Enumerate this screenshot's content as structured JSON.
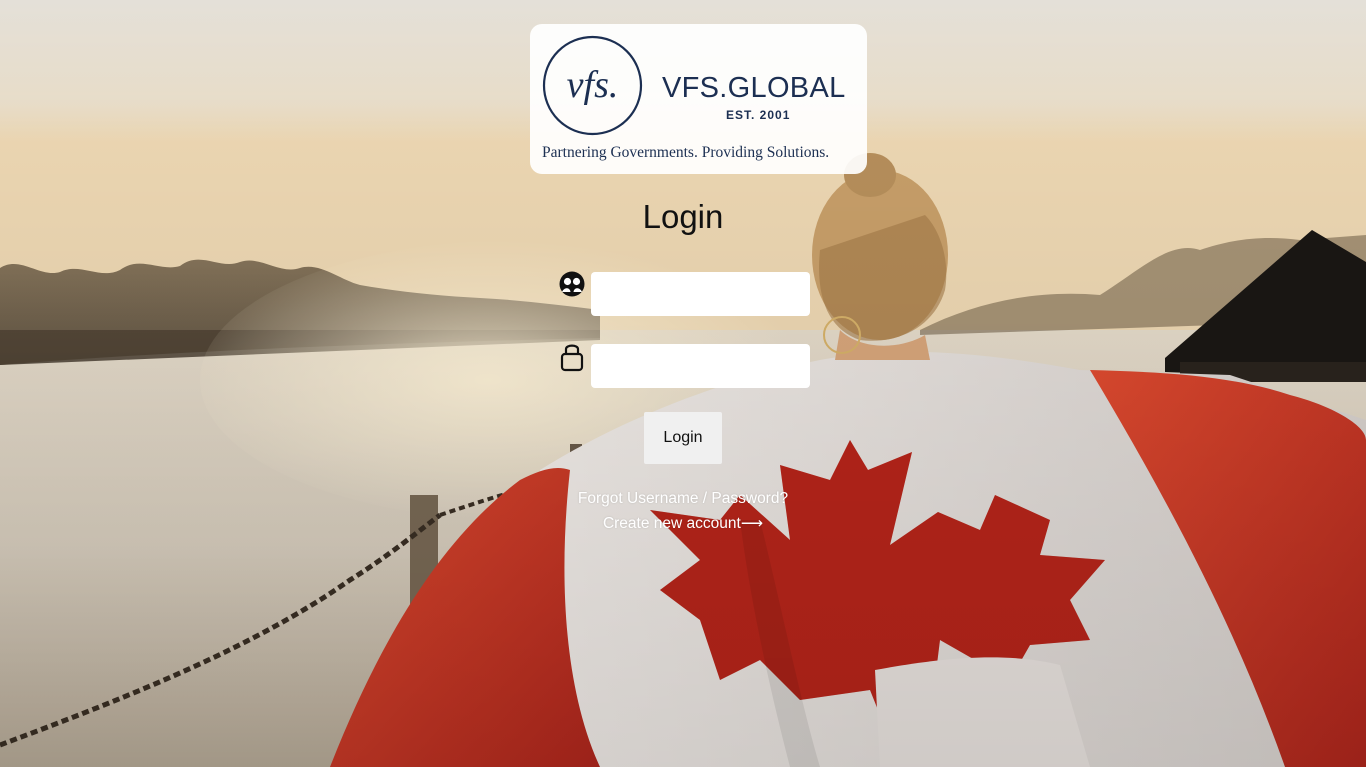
{
  "brand": {
    "emblem_text": "vfs.",
    "wordmark": "VFS.GLOBAL",
    "established": "EST. 2001",
    "tagline": "Partnering Governments. Providing Solutions."
  },
  "login": {
    "title": "Login",
    "username": {
      "value": "",
      "placeholder": "",
      "icon": "user-icon"
    },
    "password": {
      "value": "",
      "placeholder": "",
      "icon": "lock-icon"
    },
    "submit_label": "Login"
  },
  "links": {
    "forgot": "Forgot Username / Password?",
    "create_account": "Create new account",
    "create_account_arrow": "⟶"
  },
  "background": {
    "description_colors": {
      "sky": "#e8e2d6",
      "flag_red": "#d83a2a",
      "brand_navy": "#1c2f52"
    }
  }
}
